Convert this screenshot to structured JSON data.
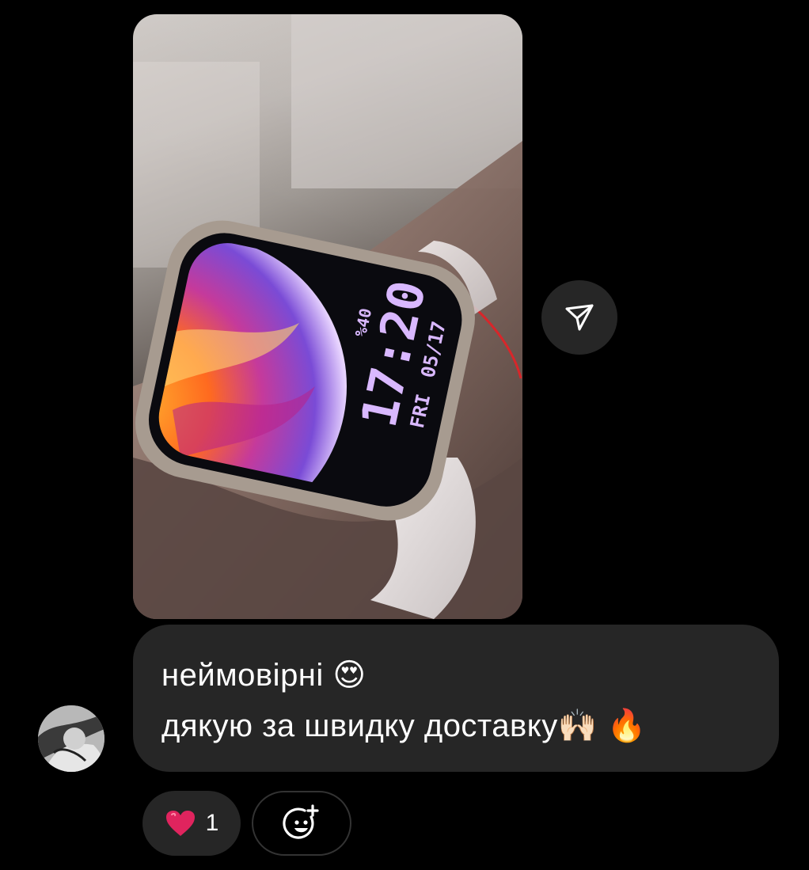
{
  "message": {
    "line1": "неймовірні 😍",
    "line2": "дякую за швидку доставку🙌🏻 🔥"
  },
  "reactions": [
    {
      "emoji": "❤️",
      "count": "1"
    }
  ],
  "watch_face": {
    "time": "17:20",
    "day": "FRI",
    "date": "05/17",
    "battery": "%40"
  },
  "icons": {
    "share": "paper-plane-icon",
    "add_reaction": "smiley-plus-icon",
    "heart": "heart-icon"
  },
  "colors": {
    "background": "#000000",
    "bubble": "#262626",
    "heart": "#e0245e",
    "watch_text": "#d9b8ff"
  }
}
